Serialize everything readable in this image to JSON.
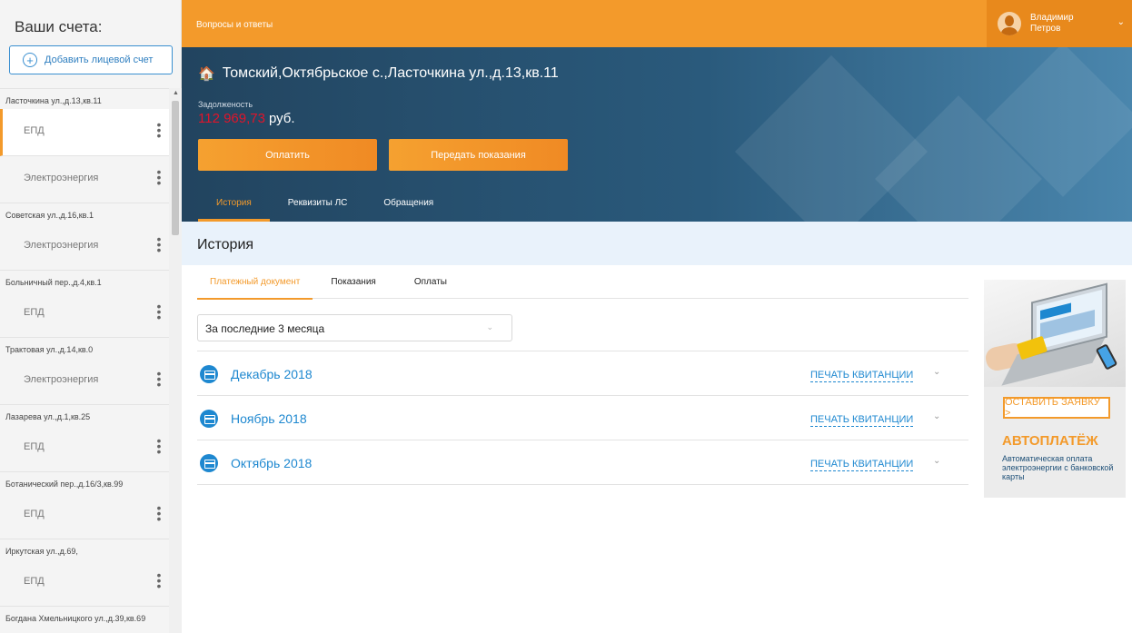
{
  "sidebar": {
    "title": "Ваши счета:",
    "add_button": "Добавить лицевой счет",
    "accounts": [
      {
        "address": "Ласточкина ул.,д.13,кв.11",
        "items": [
          {
            "label": "ЕПД",
            "active": true
          },
          {
            "label": "Электроэнергия"
          }
        ]
      },
      {
        "address": "Советская ул.,д.16,кв.1",
        "items": [
          {
            "label": "Электроэнергия"
          }
        ]
      },
      {
        "address": "Больничный пер.,д.4,кв.1",
        "items": [
          {
            "label": "ЕПД"
          }
        ]
      },
      {
        "address": "Трактовая ул.,д.14,кв.0",
        "items": [
          {
            "label": "Электроэнергия"
          }
        ]
      },
      {
        "address": "Лазарева ул.,д.1,кв.25",
        "items": [
          {
            "label": "ЕПД"
          }
        ]
      },
      {
        "address": "Ботанический пер.,д.16/3,кв.99",
        "items": [
          {
            "label": "ЕПД"
          }
        ]
      },
      {
        "address": "Иркутская ул.,д.69,",
        "items": [
          {
            "label": "ЕПД"
          }
        ]
      },
      {
        "address": "Богдана Хмельницкого ул.,д.39,кв.69",
        "items": []
      }
    ]
  },
  "topbar": {
    "faq_link": "Вопросы и ответы",
    "user_first": "Владимир",
    "user_last": "Петров"
  },
  "hero": {
    "address": "Томский,Октябрьское с.,Ласточкина ул.,д.13,кв.11",
    "debt_label": "Задолженость",
    "debt_amount": "112 969,73",
    "debt_currency": "руб.",
    "pay_button": "Оплатить",
    "meter_button": "Передать показания",
    "tabs": [
      "История",
      "Реквизиты ЛС",
      "Обращения"
    ]
  },
  "history": {
    "title": "История",
    "tabs": [
      "Платежный документ",
      "Показания",
      "Оплаты"
    ],
    "period": "За последние 3 месяца",
    "print_label": "ПЕЧАТЬ КВИТАНЦИИ",
    "months": [
      "Декабрь 2018",
      "Ноябрь 2018",
      "Октябрь 2018"
    ]
  },
  "ad": {
    "button": "ОСТАВИТЬ ЗАЯВКУ >",
    "title": "АВТОПЛАТЁЖ",
    "text": "Автоматическая оплата электроэнергии с банковской карты"
  },
  "colors": {
    "accent_orange": "#f39a2b",
    "link_blue": "#1e88d0",
    "hero_dark": "#22445f",
    "debt_red": "#e0142a"
  }
}
